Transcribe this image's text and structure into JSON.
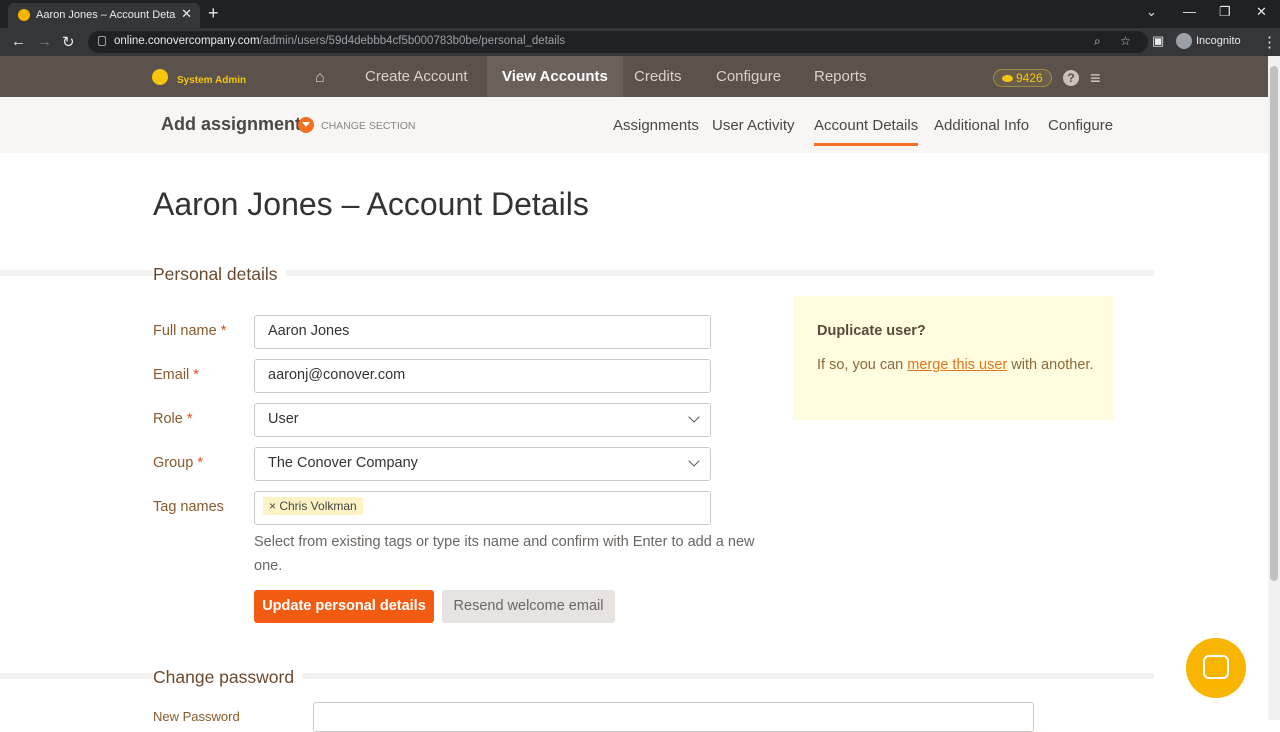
{
  "browser": {
    "tab_title": "Aaron Jones – Account Details | C",
    "url_host": "online.conovercompany.com",
    "url_path": "/admin/users/59d4debbb4cf5b000783b0be/personal_details",
    "profile_label": "Incognito"
  },
  "nav": {
    "logo_text": "System Admin",
    "items": [
      {
        "label": "Create Account"
      },
      {
        "label": "View Accounts"
      },
      {
        "label": "Credits"
      },
      {
        "label": "Configure"
      },
      {
        "label": "Reports"
      }
    ],
    "credits": "9426",
    "help": "?"
  },
  "subheader": {
    "title": "Add assignment",
    "change_section": "CHANGE SECTION",
    "tabs": [
      {
        "label": "Assignments"
      },
      {
        "label": "User Activity"
      },
      {
        "label": "Account Details"
      },
      {
        "label": "Additional Info"
      },
      {
        "label": "Configure"
      }
    ]
  },
  "page": {
    "title": "Aaron Jones – Account Details"
  },
  "personal": {
    "heading": "Personal details",
    "fields": {
      "full_name_label": "Full name",
      "full_name_value": "Aaron Jones",
      "email_label": "Email",
      "email_value": "aaronj@conover.com",
      "role_label": "Role",
      "role_value": "User",
      "group_label": "Group",
      "group_value": "The Conover Company",
      "tags_label": "Tag names",
      "tag_chip": "× Chris Volkman"
    },
    "required_mark": "*",
    "help_text": "Select from existing tags or type its name and confirm with Enter to add a new one.",
    "update_button": "Update personal details",
    "resend_button": "Resend welcome email"
  },
  "duplicate": {
    "title": "Duplicate user?",
    "text_before": "If so, you can ",
    "link": "merge this user",
    "text_after": " with another."
  },
  "password": {
    "heading": "Change password",
    "new_password_label": "New Password"
  },
  "colors": {
    "accent": "#f37021",
    "nav_bg": "#5b524b",
    "primary_button": "#f25c12"
  }
}
